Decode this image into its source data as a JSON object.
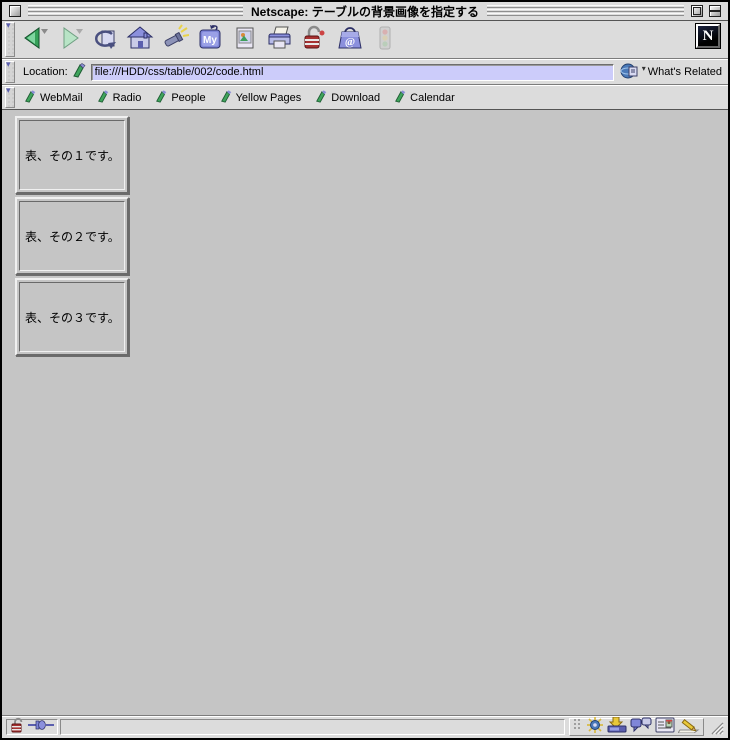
{
  "window": {
    "title": "Netscape: テーブルの背景画像を指定する",
    "logo_letter": "N"
  },
  "toolbar": {
    "icons": [
      "back",
      "forward",
      "reload",
      "home",
      "search",
      "my-netscape",
      "images",
      "print",
      "security",
      "shop",
      "stop"
    ],
    "my_label": "My"
  },
  "location": {
    "label": "Location:",
    "value": "file:///HDD/css/table/002/code.html",
    "whats_related_label": "What's Related"
  },
  "personal_toolbar": {
    "items": [
      {
        "label": "WebMail"
      },
      {
        "label": "Radio"
      },
      {
        "label": "People"
      },
      {
        "label": "Yellow Pages"
      },
      {
        "label": "Download"
      },
      {
        "label": "Calendar"
      }
    ]
  },
  "content": {
    "tables": [
      {
        "text": "表、その１です。"
      },
      {
        "text": "表、その２です。"
      },
      {
        "text": "表、その３です。"
      }
    ]
  },
  "status_bar": {
    "message": "",
    "security": "unlocked",
    "components": [
      "navigator",
      "mailbox",
      "discussions",
      "address-book",
      "composer"
    ]
  },
  "colors": {
    "platinum": "#dcdcdc",
    "page_background": "#c5c5c5",
    "selection_field": "#ccccfa",
    "accent_green": "#35a159",
    "accent_lavender": "#8b90dd",
    "security_red": "#a83232"
  }
}
